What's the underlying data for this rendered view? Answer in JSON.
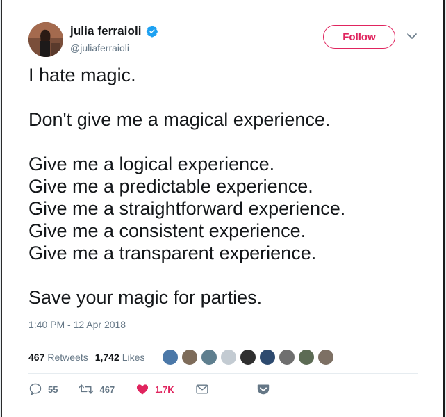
{
  "author": {
    "name": "julia ferraioli",
    "handle": "@juliaferraioli",
    "verified": true
  },
  "follow_label": "Follow",
  "tweet_lines": [
    "I hate magic.",
    "",
    "Don't give me a magical experience.",
    "",
    "Give me a logical experience.",
    "Give me a predictable experience.",
    "Give me a straightforward experience.",
    "Give me a consistent experience.",
    "Give me a transparent experience.",
    "",
    "Save your magic for parties."
  ],
  "timestamp": "1:40 PM - 12 Apr 2018",
  "stats": {
    "retweets_count": "467",
    "retweets_label": "Retweets",
    "likes_count": "1,742",
    "likes_label": "Likes"
  },
  "liker_avatars": [
    "#4b78a8",
    "#7e6c5a",
    "#5f7f8f",
    "#c3cbd2",
    "#2f2f2f",
    "#2d4a6f",
    "#6f6f6f",
    "#5c6b54",
    "#7d7064"
  ],
  "actions": {
    "reply_count": "55",
    "retweet_count": "467",
    "like_count": "1.7K"
  },
  "colors": {
    "accent": "#e0245e",
    "verified": "#1da1f2",
    "muted": "#657786"
  }
}
